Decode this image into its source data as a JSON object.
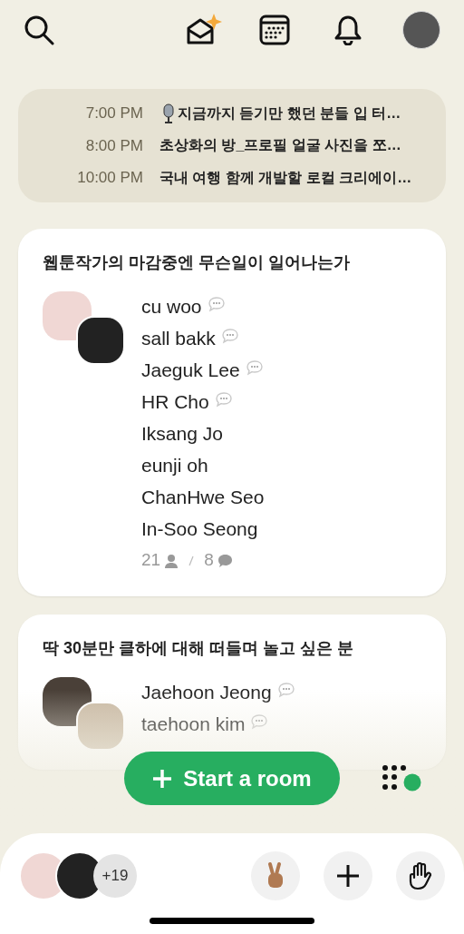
{
  "schedule": [
    {
      "time": "7:00 PM",
      "title": "지금까지 듣기만 했던 분들 입 터…",
      "kind": "mic"
    },
    {
      "time": "8:00 PM",
      "title": "초상화의 방_프로필 얼굴 사진을 쪼…",
      "kind": "plain"
    },
    {
      "time": "10:00 PM",
      "title": "국내 여행 함께 개발할 로컬 크리에이…",
      "kind": "plain"
    }
  ],
  "rooms": [
    {
      "title": "웹툰작가의 마감중엔 무슨일이 일어나는가",
      "speakers": [
        {
          "name": "cu woo",
          "speaker": true
        },
        {
          "name": "sall bakk",
          "speaker": true
        },
        {
          "name": "Jaeguk Lee",
          "speaker": true
        },
        {
          "name": "HR Cho",
          "speaker": true
        },
        {
          "name": "Iksang Jo",
          "speaker": false
        },
        {
          "name": "eunji oh",
          "speaker": false
        },
        {
          "name": "ChanHwe Seo",
          "speaker": false
        },
        {
          "name": "In-Soo Seong",
          "speaker": false
        }
      ],
      "listeners": "21",
      "speaking": "8"
    },
    {
      "title": "딱 30분만 클하에 대해 떠들며 놀고 싶은 분",
      "speakers": [
        {
          "name": "Jaehoon Jeong",
          "speaker": true
        },
        {
          "name": "taehoon kim",
          "speaker": true
        }
      ]
    }
  ],
  "start_button": "Start a room",
  "bottom_bar": {
    "more_count": "+19"
  }
}
